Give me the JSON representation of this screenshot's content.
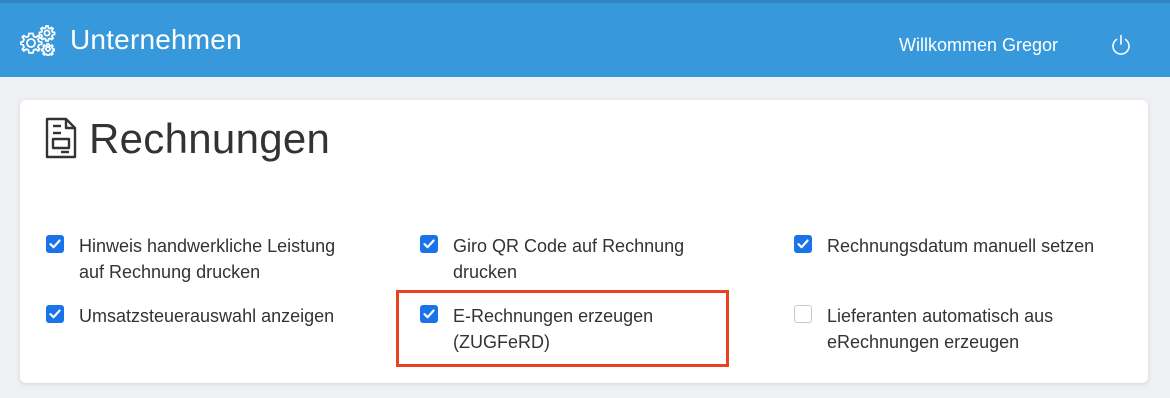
{
  "header": {
    "title": "Unternehmen",
    "welcome": "Willkommen Gregor",
    "logo_icon": "gears-icon",
    "logout_icon": "power-icon",
    "colors": {
      "bar": "#3799dc"
    }
  },
  "section": {
    "title": "Rechnungen",
    "icon": "invoice-document-icon"
  },
  "options": {
    "handwerk": {
      "line1": "Hinweis handwerkliche Leistung",
      "line2": "auf Rechnung drucken",
      "checked": true
    },
    "giro": {
      "line1": "Giro QR Code auf Rechnung",
      "line2": "drucken",
      "checked": true
    },
    "datum": {
      "line1": "Rechnungsdatum manuell setzen",
      "checked": true
    },
    "umsatz": {
      "line1": "Umsatzsteuerauswahl anzeigen",
      "checked": true
    },
    "erechnung": {
      "line1": "E-Rechnungen erzeugen",
      "line2": "(ZUGFeRD)",
      "checked": true
    },
    "lieferanten": {
      "line1": "Lieferanten automatisch aus",
      "line2": "eRechnungen erzeugen",
      "checked": false
    }
  },
  "colors": {
    "checkbox": "#1a73e8",
    "highlight": "#e8431f"
  }
}
